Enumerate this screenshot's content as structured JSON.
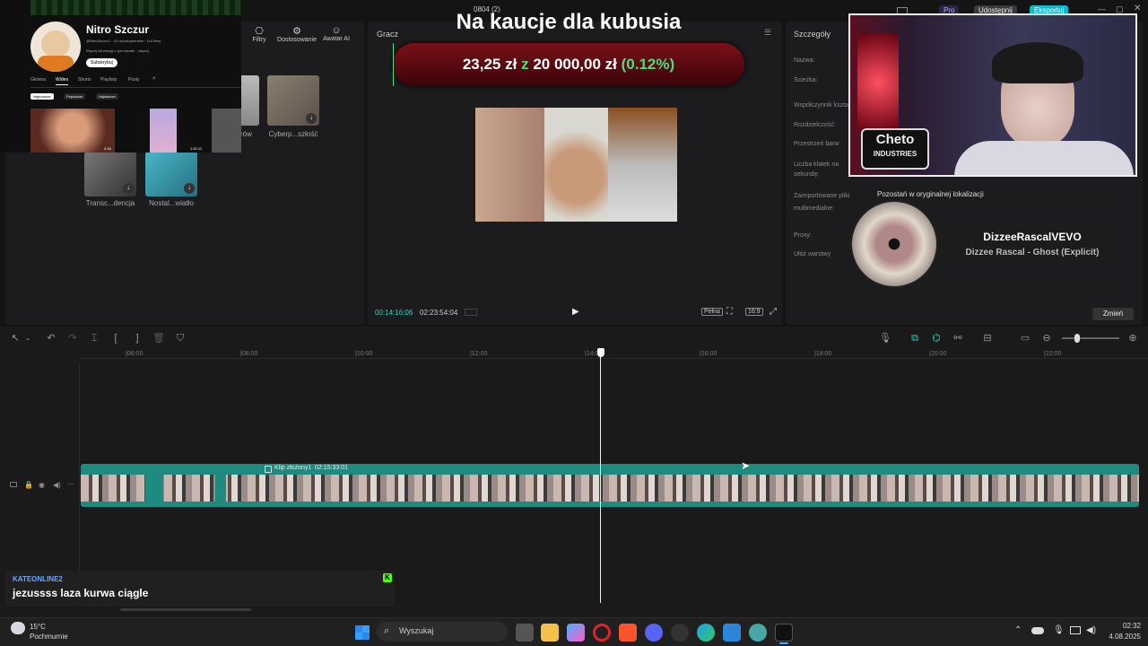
{
  "window": {
    "project_name": "0804 (2)",
    "pro_label": "Pro",
    "share_label": "Udostępnij",
    "export_label": "Eksportuj"
  },
  "media_toolbar": {
    "filters": "Filtry",
    "adjust": "Dostosowanie",
    "avatar_ai": "Awatar AI"
  },
  "media_items": [
    {
      "caption": "...iorów"
    },
    {
      "caption": "Cyberp...szłość"
    },
    {
      "caption": "Transc...dencja"
    },
    {
      "caption": "Nostal...wiatło"
    }
  ],
  "youtube": {
    "channel_name": "Nitro Szczur",
    "meta": "@NitroSzczur1 · 4/1 subskrybentów · 1x4 filmy",
    "more": "Więcej informacji o tym kanale ...więcej",
    "subscribe": "Subskrybuj",
    "tabs": [
      "Główna",
      "Wideo",
      "Shorts",
      "Playlisty",
      "Posty"
    ],
    "filters": [
      "Najnowsze",
      "Popularne",
      "Najstarsze"
    ],
    "durations": [
      "3:16",
      "1:20:11"
    ]
  },
  "player": {
    "label": "Gracz",
    "current_time": "00:14:16:06",
    "total_time": "02:23:54:04",
    "full_label": "Pełna",
    "ratio_label": "16:9"
  },
  "overlay": {
    "title": "Na kaucje dla kubusia",
    "amount": "23,25 zł",
    "separator": "z",
    "goal": "20 000,00 zł",
    "percent": "(0.12%)",
    "progress_fraction": 0.0012
  },
  "details": {
    "title": "Szczegóły",
    "fields": [
      "Nazwa:",
      "Ścieżka:",
      "Współczynnik kształtu:",
      "Rozdzielczość:",
      "Przestrzeń barw",
      "Liczba klatek na sekundę:",
      "Zaimportowane pliki multimedialne:",
      "Proxy:",
      "Ułóż warstwy"
    ],
    "import_value": "Pozostań w oryginalnej lokalizacji",
    "change_button": "Zmień"
  },
  "now_playing": {
    "artist": "DizzeeRascalVEVO",
    "track": "Dizzee Rascal - Ghost (Explicit)"
  },
  "webcam": {
    "logo_line1": "Cheto",
    "logo_line2": "INDUSTRIES"
  },
  "timeline": {
    "ticks": [
      "|06:00",
      "|08:00",
      "|10:00",
      "|12:00",
      "|14:00",
      "|16:00",
      "|18:00",
      "|20:00",
      "|22:00"
    ],
    "clip_label": "Klip złożony1",
    "clip_duration": "02:15:33:01"
  },
  "chat": {
    "user": "KATEONLINE2",
    "message": "jezussss laza kurwa ciągle"
  },
  "taskbar": {
    "temperature": "15°C",
    "weather": "Pochmurnie",
    "search": "Wyszukaj",
    "time": "02:32",
    "date": "4.08.2025"
  },
  "colors": {
    "accent": "#2dd4bf",
    "clip": "#1f8a80",
    "overlay_green": "#4ade80",
    "overlay_bar": "#5a0a10"
  }
}
